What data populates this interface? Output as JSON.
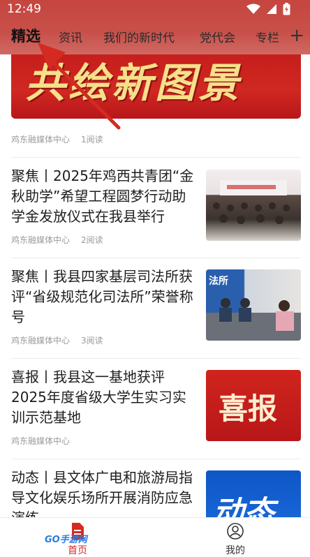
{
  "status_bar": {
    "time": "12:49"
  },
  "tabs": [
    {
      "label": "精选",
      "active": true
    },
    {
      "label": "资讯"
    },
    {
      "label": "我们的新时代"
    },
    {
      "label": "党代会"
    },
    {
      "label": "专栏"
    }
  ],
  "tab_more_symbol": "+",
  "banner": {
    "text": "共绘新图景",
    "source": "鸡东融媒体中心",
    "reads": "1阅读"
  },
  "articles": [
    {
      "title": "聚焦丨2025年鸡西共青团“金秋助学”希望工程圆梦行动助学金发放仪式在我县举行",
      "source": "鸡东融媒体中心",
      "reads": "2阅读"
    },
    {
      "title": "聚焦丨我县四家基层司法所获评“省级规范化司法所”荣誉称号",
      "source": "鸡东融媒体中心",
      "reads": "3阅读",
      "thumb_label": "法所"
    },
    {
      "title": "喜报丨我县这一基地获评2025年度省级大学生实习实训示范基地",
      "source": "鸡东融媒体中心",
      "reads": "",
      "thumb_label": "喜报"
    },
    {
      "title": "动态丨县文体广电和旅游局指导文化娱乐场所开展消防应急演练",
      "source": "",
      "reads": "",
      "thumb_label": "动态"
    }
  ],
  "bottom_nav": {
    "home": "首页",
    "me": "我的"
  },
  "watermark": "GO手游网",
  "colors": {
    "accent": "#d52a22",
    "banner_red": "#c41d1a"
  }
}
